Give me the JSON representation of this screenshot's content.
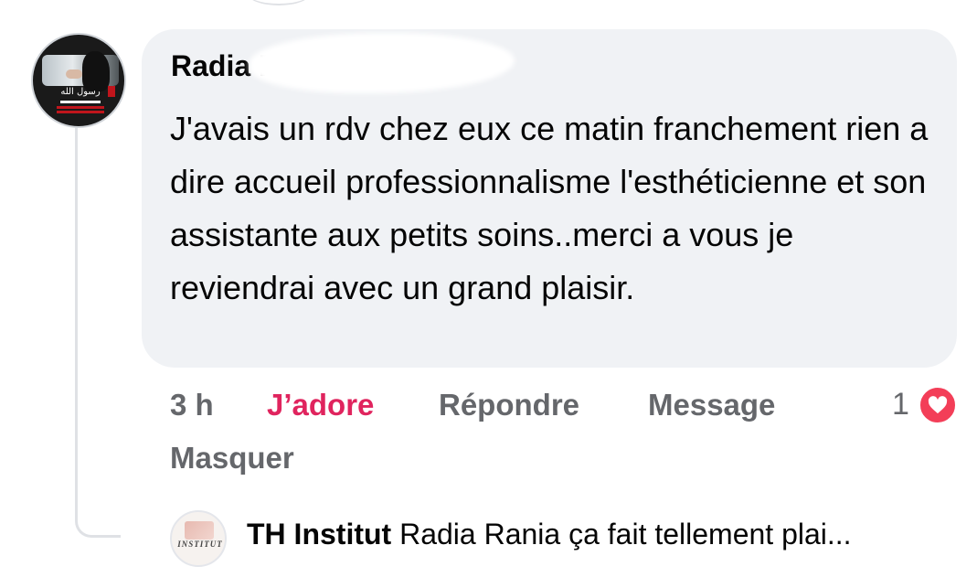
{
  "comment": {
    "author": "Radia R..",
    "text": "J'avais un rdv chez eux ce matin franchement rien a dire accueil professionnalisme l'esthéticienne et son assistante aux petits soins..merci a vous je reviendrai avec un grand plaisir."
  },
  "actions": {
    "time": "3 h",
    "reaction_label": "J’adore",
    "reply_label": "Répondre",
    "message_label": "Message",
    "hide_label": "Masquer",
    "reaction_count": "1"
  },
  "reply_preview": {
    "author": "TH Institut",
    "text": "Radia Rania ça fait tellement plai...",
    "avatar_text": "INSTITUT"
  },
  "icons": {
    "reaction": "heart-icon",
    "reaction_color": "#f33e58"
  },
  "colors": {
    "bubble": "#f0f2f5",
    "action_text": "#65676b",
    "love_text": "#e0245e"
  }
}
